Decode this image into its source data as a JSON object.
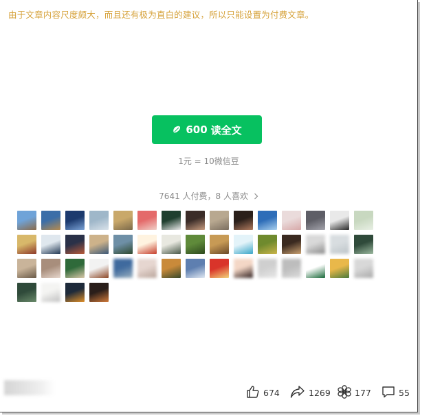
{
  "notice": "由于文章内容尺度颇大，而且还有极为直白的建议，所以只能设置为付费文章。",
  "pay": {
    "amount": "600",
    "label": "读全文",
    "rate": "1元 = 10微信豆"
  },
  "stats": {
    "payers": "7641 人付费，8 人喜欢"
  },
  "colors": {
    "accent": "#07c160",
    "notice": "#d6a23a"
  },
  "avatars": [
    {
      "c1": "#6fa3d8",
      "c2": "#8a6b4a"
    },
    {
      "c1": "#3b6ea8",
      "c2": "#b58a4e"
    },
    {
      "c1": "#1c3a6e",
      "c2": "#7aa2d6"
    },
    {
      "c1": "#9fb7c9",
      "c2": "#d9e2ea"
    },
    {
      "c1": "#c9a86a",
      "c2": "#7c6a4a"
    },
    {
      "c1": "#e46a6a",
      "c2": "#f0d0c8"
    },
    {
      "c1": "#1f3f2f",
      "c2": "#e8e8e8"
    },
    {
      "c1": "#3a2c28",
      "c2": "#c79b7e"
    },
    {
      "c1": "#b8a890",
      "c2": "#7c6f60"
    },
    {
      "c1": "#2a1f1a",
      "c2": "#b07a5e"
    },
    {
      "c1": "#2e6db8",
      "c2": "#a8cfee"
    },
    {
      "c1": "#eadbdb",
      "c2": "#d7a9a9"
    },
    {
      "c1": "#5e5e66",
      "c2": "#a4a4ac"
    },
    {
      "c1": "#e9e9e9",
      "c2": "#2a2a2a"
    },
    {
      "c1": "#c8d8c0",
      "c2": "#e8efe4"
    },
    {
      "c1": "#d8b86a",
      "c2": "#8e3a2a"
    },
    {
      "c1": "#dfe7ee",
      "c2": "#243a55"
    },
    {
      "c1": "#2a3148",
      "c2": "#b85a3a"
    },
    {
      "c1": "#cdb28a",
      "c2": "#3e5a78"
    },
    {
      "c1": "#6e8fa6",
      "c2": "#2f4a2f"
    },
    {
      "c1": "#fff3e0",
      "c2": "#c7402e"
    },
    {
      "c1": "#e8e8e0",
      "c2": "#4a5a4a"
    },
    {
      "c1": "#5f8a3a",
      "c2": "#2e4a1e"
    },
    {
      "c1": "#c79a55",
      "c2": "#6b4a2a"
    },
    {
      "c1": "#e3f3f9",
      "c2": "#3aa7c9"
    },
    {
      "c1": "#6f8a2e",
      "c2": "#c9b44a"
    },
    {
      "c1": "#3a2a20",
      "c2": "#c9a070"
    },
    {
      "c1": "#d9d9d9",
      "c2": "#8a8a8a"
    },
    {
      "c1": "#d8dde0",
      "c2": "#bcc4c8"
    },
    {
      "c1": "#2f4a3a",
      "c2": "#9ab89e"
    },
    {
      "c1": "#c9b49a",
      "c2": "#6a5a48"
    },
    {
      "c1": "#a88e7c",
      "c2": "#e6d6cc"
    },
    {
      "c1": "#2f6a3a",
      "c2": "#d9c7a9"
    },
    {
      "c1": "#f2f2f2",
      "c2": "#8e4a2a"
    },
    {
      "c1": "#3f6a9e",
      "c2": "#9ab0c0"
    },
    {
      "c1": "#e6d6d0",
      "c2": "#b8a49a"
    },
    {
      "c1": "#c98a3a",
      "c2": "#3a4a2a"
    },
    {
      "c1": "#5e7fb0",
      "c2": "#e0e8f2"
    },
    {
      "c1": "#d9342a",
      "c2": "#f2d27a"
    },
    {
      "c1": "#f4d7c6",
      "c2": "#2a1a1a"
    },
    {
      "c1": "#cfcfcf",
      "c2": "#e8e8e8"
    },
    {
      "c1": "#bdbdbd",
      "c2": "#dcdcdc"
    },
    {
      "c1": "#ffffff",
      "c2": "#1a6a3a"
    },
    {
      "c1": "#e9b84a",
      "c2": "#4a7a3a"
    },
    {
      "c1": "#d8d8d8",
      "c2": "#a8a8a8"
    },
    {
      "c1": "#2f4a3a",
      "c2": "#6a8a6a"
    },
    {
      "c1": "#f4f4f2",
      "c2": "#c0c0c0"
    },
    {
      "c1": "#1e2a3a",
      "c2": "#e0902a"
    },
    {
      "c1": "#2a1e1a",
      "c2": "#d07a3a"
    }
  ],
  "avatar_blurred": [
    27,
    28,
    34,
    35,
    39,
    40,
    41,
    44,
    46
  ],
  "actions": [
    {
      "icon": "thumbs-up-icon",
      "count": "674"
    },
    {
      "icon": "share-icon",
      "count": "1269"
    },
    {
      "icon": "flower-icon",
      "count": "177"
    },
    {
      "icon": "comment-icon",
      "count": "55"
    }
  ]
}
